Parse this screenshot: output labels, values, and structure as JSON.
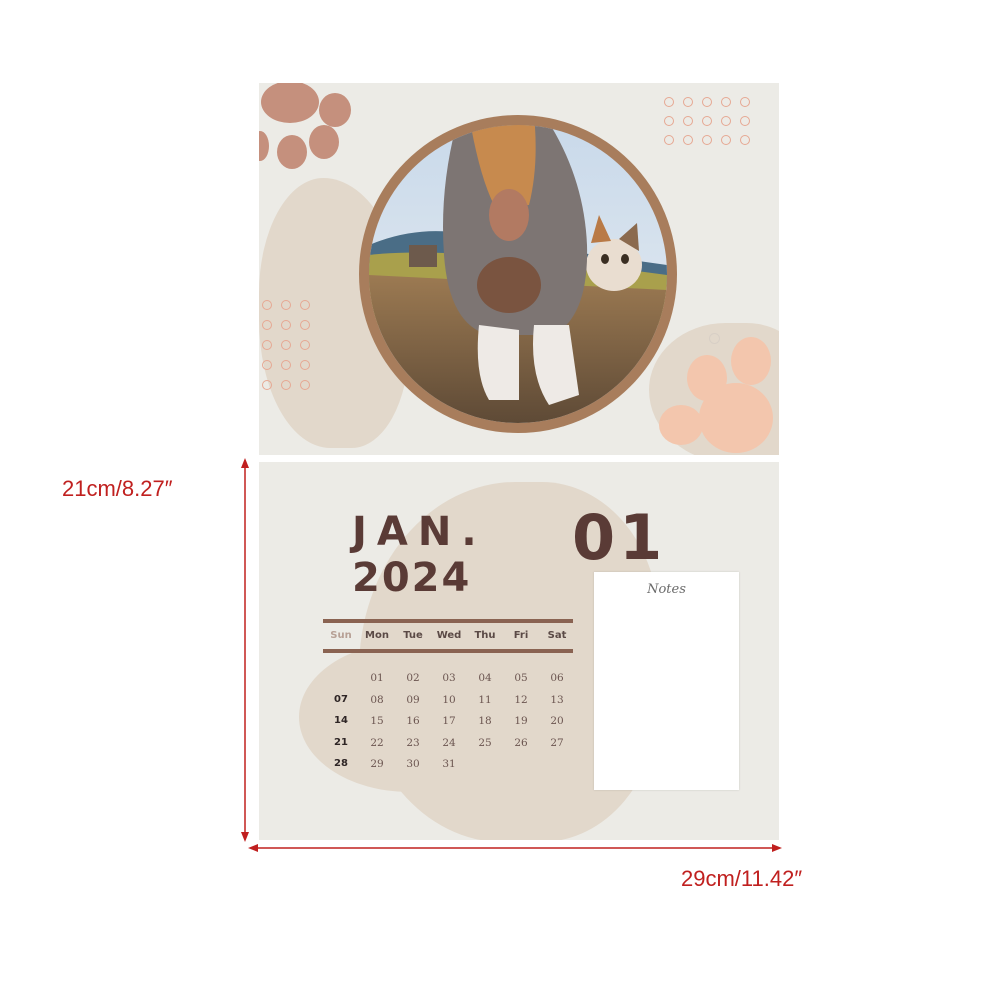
{
  "calendar": {
    "month": "JAN.",
    "year": "2024",
    "month_number": "01",
    "notes_title": "Notes",
    "weekday_headers": [
      "Sun",
      "Mon",
      "Tue",
      "Wed",
      "Thu",
      "Fri",
      "Sat"
    ],
    "weeks": [
      [
        "",
        "01",
        "02",
        "03",
        "04",
        "05",
        "06"
      ],
      [
        "07",
        "08",
        "09",
        "10",
        "11",
        "12",
        "13"
      ],
      [
        "14",
        "15",
        "16",
        "17",
        "18",
        "19",
        "20"
      ],
      [
        "21",
        "22",
        "23",
        "24",
        "25",
        "26",
        "27"
      ],
      [
        "28",
        "29",
        "30",
        "31",
        "",
        "",
        ""
      ]
    ]
  },
  "dimensions": {
    "height_label": "21cm/8.27″",
    "width_label": "29cm/11.42″"
  },
  "colors": {
    "page_background": "#ecebe6",
    "accent_brown": "#5a3b36",
    "paw_brown": "#c5907d",
    "paw_peach": "#f3c6ad",
    "dimension_red": "#c0201f"
  }
}
